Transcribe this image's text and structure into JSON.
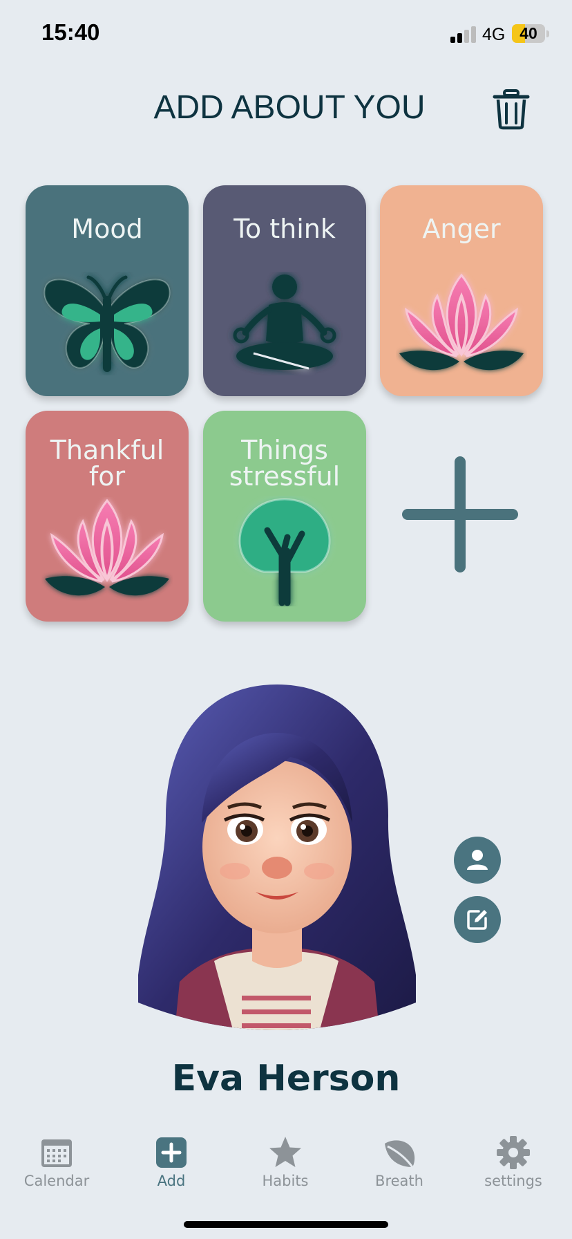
{
  "status_bar": {
    "time": "15:40",
    "network": "4G",
    "battery": "40",
    "battery_level": 0.4
  },
  "header": {
    "title": "ADD ABOUT YOU",
    "delete_icon": "trash-icon"
  },
  "cards": [
    {
      "label": "Mood",
      "icon": "butterfly-icon",
      "color": "#4a727c"
    },
    {
      "label": "To think",
      "icon": "meditation-icon",
      "color": "#585a74"
    },
    {
      "label": "Anger",
      "icon": "lotus-icon",
      "color": "#f0b291"
    },
    {
      "label_line1": "Thankful",
      "label_line2": "for",
      "icon": "lotus-icon",
      "color": "#cf7c7c"
    },
    {
      "label_line1": "Things",
      "label_line2": "stressful",
      "icon": "tree-icon",
      "color": "#8cca8e"
    }
  ],
  "add_card_icon": "plus-icon",
  "profile": {
    "name": "Eva Herson",
    "avatar": "girl-portrait-avatar",
    "profile_icon": "user-icon",
    "edit_icon": "edit-icon"
  },
  "tabs": [
    {
      "label": "Calendar",
      "icon": "calendar-icon",
      "active": false
    },
    {
      "label": "Add",
      "icon": "plus-square-icon",
      "active": true
    },
    {
      "label": "Habits",
      "icon": "star-icon",
      "active": false
    },
    {
      "label": "Breath",
      "icon": "leaf-icon",
      "active": false
    },
    {
      "label": "settings",
      "icon": "gear-icon",
      "active": false
    }
  ],
  "colors": {
    "accent": "#4a7480",
    "background": "#e6ebf0",
    "text": "#0e3340",
    "inactive": "#8d9398"
  }
}
